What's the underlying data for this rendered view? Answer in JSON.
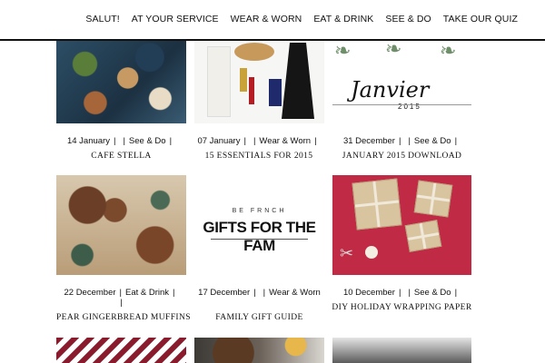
{
  "nav": {
    "items": [
      "SALUT!",
      "AT YOUR SERVICE",
      "WEAR & WORN",
      "EAT & DRINK",
      "SEE & DO",
      "TAKE OUR QUIZ"
    ]
  },
  "posts": [
    {
      "date": "14 January",
      "category": "See & Do",
      "title": "CAFE STELLA",
      "image": "cafe-table-photo"
    },
    {
      "date": "07 January",
      "category": "Wear & Worn",
      "title": "15 ESSENTIALS FOR 2015",
      "image": "fashion-essentials-photo"
    },
    {
      "date": "31 December",
      "category": "See & Do",
      "title": "JANUARY 2015 DOWNLOAD",
      "image": "janvier-calendar-graphic"
    },
    {
      "date": "22 December",
      "category": "Eat & Drink",
      "title": "PEAR GINGERBREAD MUFFINS",
      "image": "muffins-photo"
    },
    {
      "date": "17 December",
      "category": "Wear & Worn",
      "title": "FAMILY GIFT GUIDE",
      "image": "gifts-for-the-fam-graphic"
    },
    {
      "date": "10 December",
      "category": "See & Do",
      "title": "DIY HOLIDAY WRAPPING PAPER",
      "image": "wrapping-paper-photo"
    }
  ],
  "graphics": {
    "janvier_script": "Janvier",
    "janvier_year": "2015",
    "befrench_top": "BE FRNCH",
    "befrench_main": "GIFTS FOR THE FAM"
  },
  "separator": "|",
  "colors": {
    "nav_border": "#111111",
    "wrapping_bg": "#c02a44"
  }
}
